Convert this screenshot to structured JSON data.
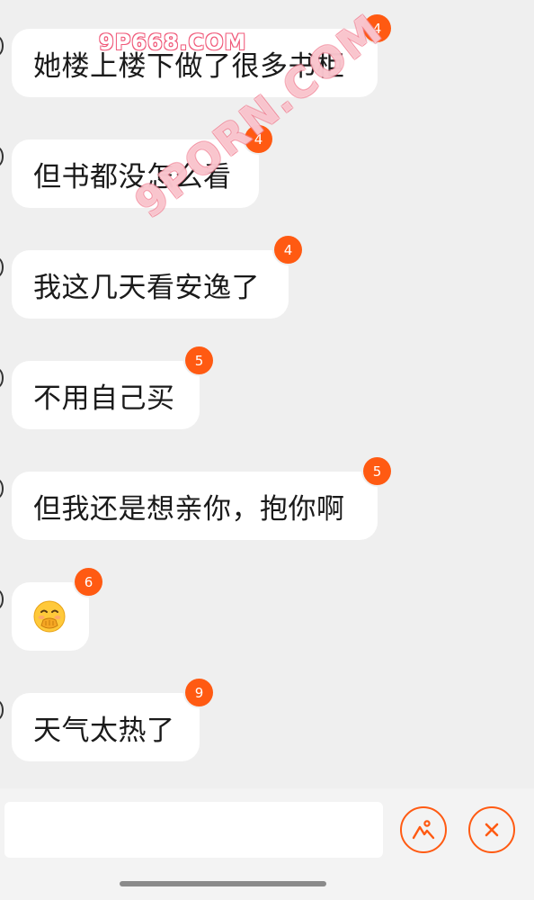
{
  "watermarks": {
    "top": "9P668.COM",
    "diagonal": "9PORN.COM"
  },
  "messages": [
    {
      "text": "她楼上楼下做了很多书柜",
      "badge": "4"
    },
    {
      "text": "但书都没怎么看",
      "badge": "4"
    },
    {
      "text": "我这几天看安逸了",
      "badge": "4"
    },
    {
      "text": "不用自己买",
      "badge": "5"
    },
    {
      "text": "但我还是想亲你，抱你啊",
      "badge": "5"
    },
    {
      "emoji": "hand-over-mouth-emoji",
      "badge": "6"
    },
    {
      "text": "天气太热了",
      "badge": "9"
    }
  ],
  "input": {
    "value": "",
    "placeholder": ""
  },
  "buttons": {
    "image_icon": "image-mountain-icon",
    "close_icon": "close-icon"
  },
  "colors": {
    "accent": "#ff5a12",
    "background": "#efefef",
    "bubble": "#ffffff"
  }
}
